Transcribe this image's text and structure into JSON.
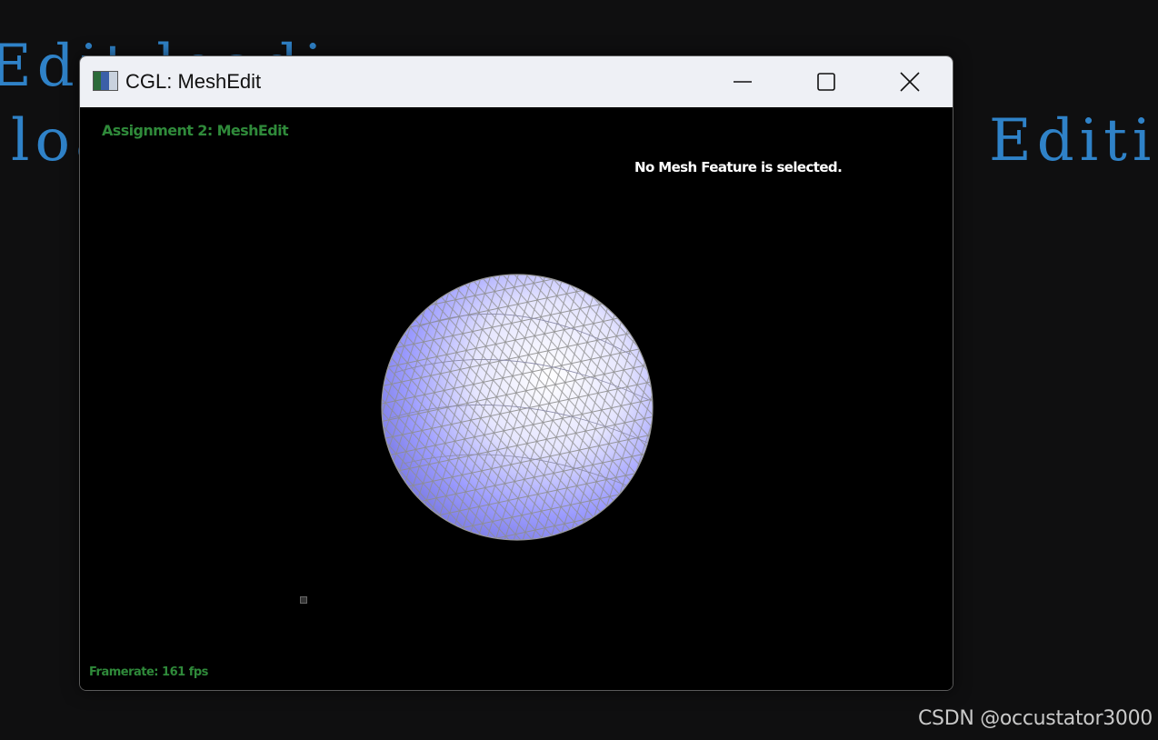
{
  "background": {
    "line1": "Edit loadi",
    "line2": "loa",
    "line3": "Editi",
    "text_color": "#2f82c8"
  },
  "window": {
    "title": "CGL: MeshEdit",
    "app_icon": "app-icon",
    "controls": {
      "minimize_icon": "minimize-icon",
      "maximize_icon": "maximize-icon",
      "close_icon": "close-icon"
    }
  },
  "viewport": {
    "assignment_label": "Assignment 2: MeshEdit",
    "selection_status": "No Mesh Feature is selected.",
    "framerate_label": "Framerate: 161 fps",
    "hud_color": "#2f8a3a",
    "mesh_fill": "#9c9cff",
    "mesh_wire": "#9a9a9a",
    "mesh_shape": "triangulated-sphere"
  },
  "watermark": "CSDN @occustator3000"
}
